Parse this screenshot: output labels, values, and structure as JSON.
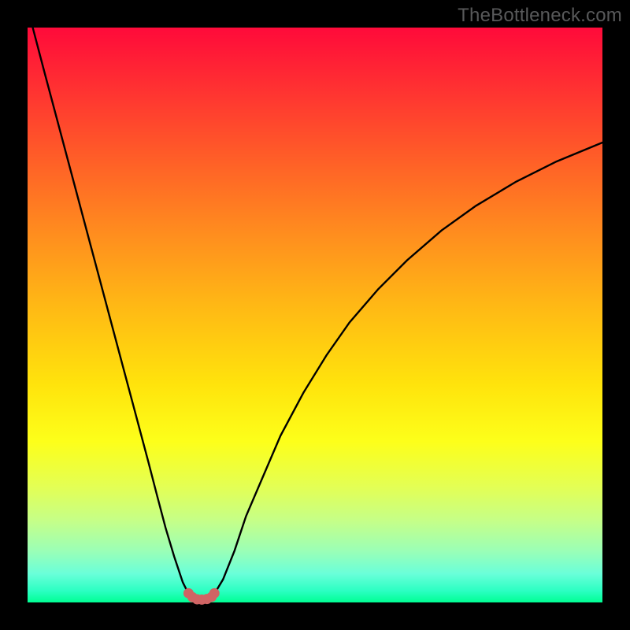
{
  "watermark": "TheBottleneck.com",
  "chart_data": {
    "type": "line",
    "title": "",
    "xlabel": "",
    "ylabel": "",
    "xlim": [
      0,
      100
    ],
    "ylim": [
      0,
      100
    ],
    "grid": false,
    "legend": false,
    "series": [
      {
        "name": "left-branch",
        "stroke": "#000",
        "x": [
          0.9,
          3,
          5,
          7,
          9,
          11,
          13,
          15,
          17,
          19,
          21,
          22.5,
          24,
          25.5,
          27,
          28
        ],
        "y": [
          100,
          92,
          84.5,
          77,
          69.5,
          62,
          54.5,
          47,
          39.5,
          32,
          24.5,
          18.7,
          13,
          8,
          3.5,
          1.5
        ]
      },
      {
        "name": "right-branch",
        "stroke": "#000",
        "x": [
          32.5,
          34,
          36,
          38,
          41,
          44,
          48,
          52,
          56,
          61,
          66,
          72,
          78,
          85,
          92,
          100
        ],
        "y": [
          1.5,
          4,
          9,
          15,
          22,
          29,
          36.5,
          43,
          48.7,
          54.5,
          59.5,
          64.7,
          69,
          73.2,
          76.7,
          80
        ]
      },
      {
        "name": "trough-dots",
        "stroke": "#d06464",
        "style": "dots",
        "x": [
          28,
          28.7,
          29.5,
          30.3,
          31.2,
          32,
          32.5
        ],
        "y": [
          1.6,
          0.9,
          0.55,
          0.5,
          0.6,
          0.95,
          1.6
        ]
      }
    ],
    "background_gradient": {
      "top_color": "#ff0a3a",
      "bottom_color": "#00ff93"
    }
  }
}
